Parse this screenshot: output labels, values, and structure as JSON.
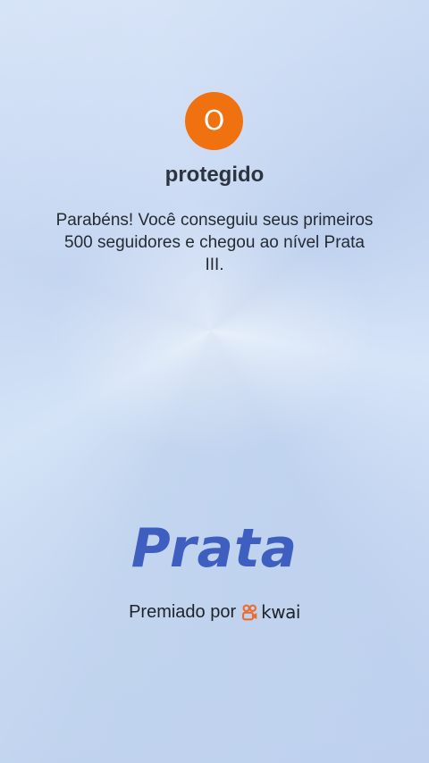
{
  "profile": {
    "avatar_initial": "O",
    "username": "protegido"
  },
  "achievement": {
    "message": "Parabéns! Você conseguiu seus primeiros 500 seguidores e chegou ao nível Prata III.",
    "level_title": "Prata"
  },
  "footer": {
    "awarded_by": "Premiado por",
    "brand_name": "kwai",
    "brand_icon": "kwai-logo-icon"
  },
  "colors": {
    "avatar_bg": "#f07110",
    "level_text": "#3f5fc0",
    "brand_icon": "#ee6a2b"
  }
}
